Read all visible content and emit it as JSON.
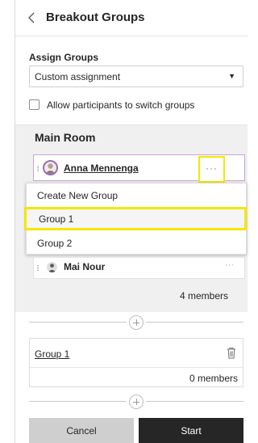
{
  "header": {
    "title": "Breakout Groups"
  },
  "assign": {
    "label": "Assign Groups",
    "selected": "Custom assignment",
    "caret": "▼"
  },
  "switch_option": {
    "label": "Allow participants to switch groups",
    "checked": false
  },
  "main_room": {
    "title": "Main Room",
    "participants": [
      {
        "name": "Anna Mennenga",
        "more": "···"
      },
      {
        "name": "Mai Nour",
        "more": "···"
      }
    ],
    "members": "4 members"
  },
  "context_menu": {
    "items": [
      "Create New Group",
      "Group 1",
      "Group 2"
    ]
  },
  "groups": [
    {
      "name": "Group 1",
      "members": "0 members"
    }
  ],
  "footer": {
    "cancel": "Cancel",
    "start": "Start"
  },
  "colors": {
    "highlight": "#f2e800",
    "avatar_ring": "#a06ab4",
    "start_bg": "#262626",
    "cancel_bg": "#cfcfcf",
    "main_room_bg": "#f0f0f0"
  }
}
